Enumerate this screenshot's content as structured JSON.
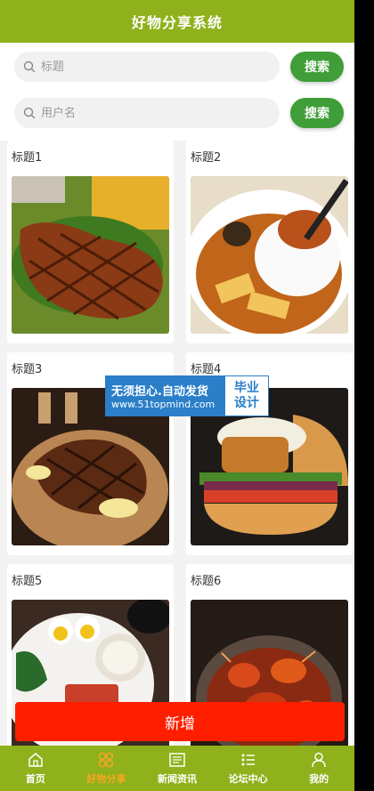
{
  "header": {
    "title": "好物分享系统"
  },
  "search": {
    "title_placeholder": "标题",
    "user_placeholder": "用户名",
    "button_label": "搜索"
  },
  "cards": [
    {
      "title": "标题1",
      "image": "grilled-steak-on-lettuce"
    },
    {
      "title": "标题2",
      "image": "rice-with-abalone-sauce"
    },
    {
      "title": "标题3",
      "image": "grilled-steak-board-lemon"
    },
    {
      "title": "标题4",
      "image": "burger"
    },
    {
      "title": "标题5",
      "image": "plate-with-eggs-and-sauce"
    },
    {
      "title": "标题6",
      "image": "crab-in-pot"
    }
  ],
  "add_button": {
    "label": "新增"
  },
  "tabs": [
    {
      "label": "首页",
      "icon": "home-icon",
      "active": false
    },
    {
      "label": "好物分享",
      "icon": "clover-icon",
      "active": true
    },
    {
      "label": "新闻资讯",
      "icon": "newspaper-icon",
      "active": false
    },
    {
      "label": "论坛中心",
      "icon": "list-icon",
      "active": false
    },
    {
      "label": "我的",
      "icon": "user-icon",
      "active": false
    }
  ],
  "watermark": {
    "line1": "无须担心.自动发货",
    "line2": "www.51topmind.com",
    "right_top": "毕业",
    "right_bottom": "设计"
  },
  "colors": {
    "primary": "#8fb11b",
    "search_button": "#3f9e37",
    "add_button": "#ff1e00",
    "active_tab": "#f5a623"
  }
}
